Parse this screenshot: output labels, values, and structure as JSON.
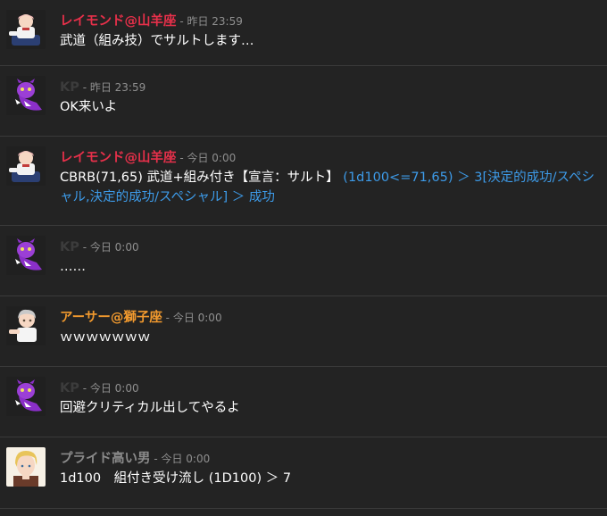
{
  "colors": {
    "background": "#232323",
    "divider": "#3a3a3a",
    "timestamp": "#8f8f8f",
    "dice_result": "#3d9be9"
  },
  "messages": [
    {
      "avatar": "chibi-raymond-avatar",
      "name": "レイモンド@山羊座",
      "name_color": "#e6304a",
      "sep": " - ",
      "time": "昨日 23:59",
      "text": "武道（組み技）でサルトします…"
    },
    {
      "avatar": "purple-ghost-avatar",
      "name": "KP",
      "name_color": "#3c3c3c",
      "sep": " - ",
      "time": "昨日 23:59",
      "text": "OK来いよ"
    },
    {
      "avatar": "chibi-raymond-avatar",
      "name": "レイモンド@山羊座",
      "name_color": "#e6304a",
      "sep": " - ",
      "time": "今日 0:00",
      "text": "CBRB(71,65) 武道+組み付き【宣言：サルト】 ",
      "dice": "(1d100<=71,65) ＞ 3[決定的成功/スペシャル,決定的成功/スペシャル] ＞ 成功"
    },
    {
      "avatar": "purple-ghost-avatar",
      "name": "KP",
      "name_color": "#3c3c3c",
      "sep": " - ",
      "time": "今日 0:00",
      "text": "……"
    },
    {
      "avatar": "chibi-arthur-avatar",
      "name": "アーサー@獅子座",
      "name_color": "#f29a2e",
      "sep": " - ",
      "time": "今日 0:00",
      "text": "ｗｗｗｗｗｗｗ"
    },
    {
      "avatar": "purple-ghost-avatar",
      "name": "KP",
      "name_color": "#3c3c3c",
      "sep": " - ",
      "time": "今日 0:00",
      "text": "回避クリティカル出してやるよ"
    },
    {
      "avatar": "blonde-man-avatar",
      "name": "プライド高い男",
      "name_color": "#8a8a8a",
      "sep": " - ",
      "time": "今日 0:00",
      "text": "1d100　組付き受け流し (1D100) ＞ 7"
    }
  ]
}
